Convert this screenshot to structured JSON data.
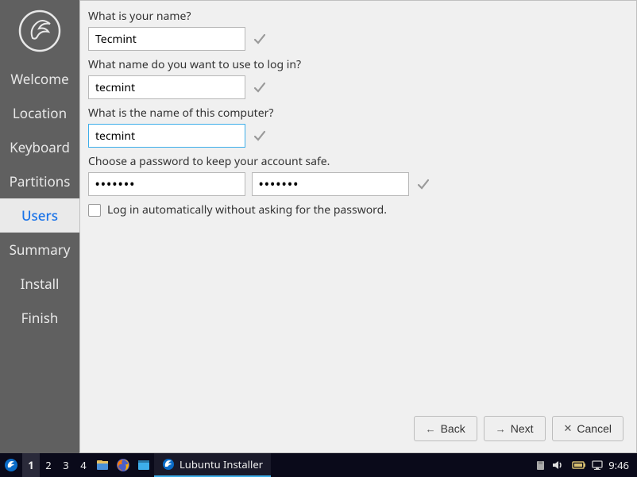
{
  "sidebar": {
    "items": [
      {
        "label": "Welcome"
      },
      {
        "label": "Location"
      },
      {
        "label": "Keyboard"
      },
      {
        "label": "Partitions"
      },
      {
        "label": "Users"
      },
      {
        "label": "Summary"
      },
      {
        "label": "Install"
      },
      {
        "label": "Finish"
      }
    ],
    "active_index": 4
  },
  "form": {
    "name": {
      "label": "What is your name?",
      "value": "Tecmint"
    },
    "login": {
      "label": "What name do you want to use to log in?",
      "value": "tecmint"
    },
    "hostname": {
      "label": "What is the name of this computer?",
      "value": "tecmint"
    },
    "password": {
      "label": "Choose a password to keep your account safe.",
      "value1": "•••••••",
      "value2": "•••••••"
    },
    "autologin": {
      "label": "Log in automatically without asking for the password.",
      "checked": false
    }
  },
  "buttons": {
    "back": "Back",
    "next": "Next",
    "cancel": "Cancel"
  },
  "taskbar": {
    "desktops": [
      "1",
      "2",
      "3",
      "4"
    ],
    "active_desktop": 0,
    "task_title": "Lubuntu Installer",
    "clock": "9:46"
  }
}
